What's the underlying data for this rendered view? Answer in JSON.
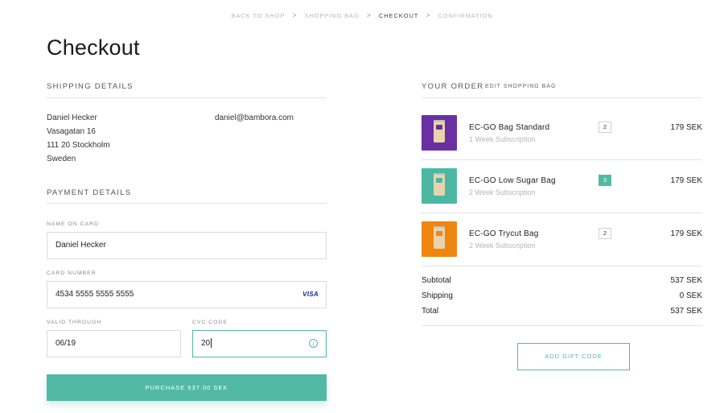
{
  "breadcrumb": {
    "items": [
      "BACK TO SHOP",
      "SHOPPING BAG",
      "CHECKOUT",
      "CONFIRMATION"
    ],
    "active_index": 2,
    "separator": ">"
  },
  "page_title": "Checkout",
  "shipping": {
    "heading": "SHIPPING DETAILS",
    "name": "Daniel Hecker",
    "street": "Vasagatan 16",
    "postal_city": "111 20 Stockholm",
    "country": "Sweden",
    "email": "daniel@bambora.com"
  },
  "payment": {
    "heading": "PAYMENT DETAILS",
    "name_label": "NAME ON CARD",
    "name_value": "Daniel Hecker",
    "card_label": "CARD NUMBER",
    "card_value": "4534 5555 5555 5555",
    "card_brand": "VISA",
    "valid_label": "VALID THROUGH",
    "valid_value": "06/19",
    "cvc_label": "CVC CODE",
    "cvc_value": "20",
    "info_icon": "info-icon",
    "purchase_label": "PURCHASE 537.00 SEK"
  },
  "order": {
    "heading": "YOUR ORDER",
    "edit_label": "EDIT SHOPPING BAG",
    "items": [
      {
        "name": "EC-GO Bag Standard",
        "subtitle": "1 Week Subscription",
        "qty": "2",
        "price": "179 SEK",
        "color": "#6a2fa0",
        "highlight": false
      },
      {
        "name": "EC-GO Low Sugar Bag",
        "subtitle": "2 Week Subscription",
        "qty": "3",
        "price": "179 SEK",
        "color": "#4cb8a4",
        "highlight": true
      },
      {
        "name": "EC-GO Trycut Bag",
        "subtitle": "2 Week Subscription",
        "qty": "2",
        "price": "179 SEK",
        "color": "#f0850f",
        "highlight": false
      }
    ],
    "subtotal_label": "Subtotal",
    "subtotal_value": "537 SEK",
    "shipping_label": "Shipping",
    "shipping_value": "0 SEK",
    "total_label": "Total",
    "total_value": "537 SEK",
    "gift_label": "ADD GIFT CODE"
  },
  "colors": {
    "accent": "#52b9a5",
    "text": "#222222",
    "muted": "#b5b5b5",
    "rule": "#e3e3e3"
  }
}
